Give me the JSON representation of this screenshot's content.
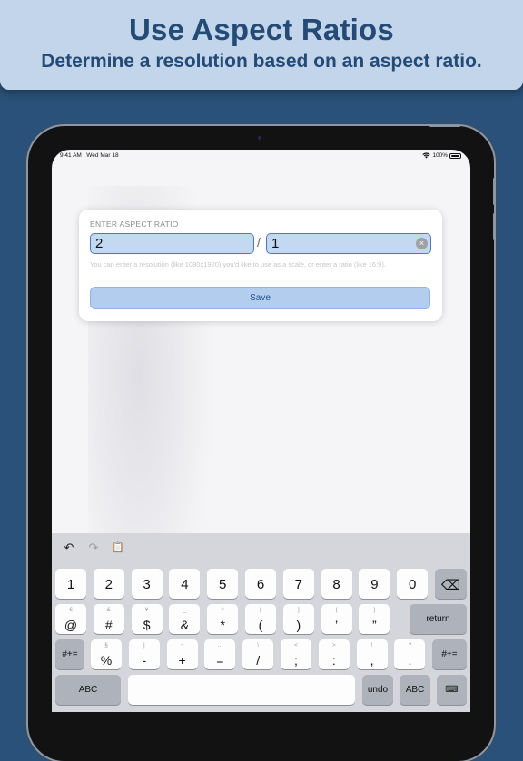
{
  "banner": {
    "title": "Use Aspect Ratios",
    "subtitle": "Determine a resolution based on an aspect ratio."
  },
  "status_bar": {
    "time": "9:41 AM",
    "date": "Wed Mar 18",
    "battery": "100%"
  },
  "dialog": {
    "label": "ENTER ASPECT RATIO",
    "width_value": "2",
    "separator": "/",
    "height_value": "1",
    "clear_glyph": "×",
    "hint": "You can enter a resolution (like 1080x1920) you'd like to use as a scale, or enter a ratio (like 16:9).",
    "save_label": "Save"
  },
  "keyboard": {
    "toolbar": {
      "undo_glyph": "↶",
      "redo_glyph": "↷",
      "paste_glyph": "📋"
    },
    "row1": [
      "1",
      "2",
      "3",
      "4",
      "5",
      "6",
      "7",
      "8",
      "9",
      "0"
    ],
    "delete_glyph": "⌫",
    "row2": [
      {
        "alt": "€",
        "main": "@"
      },
      {
        "alt": "£",
        "main": "#"
      },
      {
        "alt": "¥",
        "main": "$"
      },
      {
        "alt": "_",
        "main": "&"
      },
      {
        "alt": "^",
        "main": "*"
      },
      {
        "alt": "[",
        "main": "("
      },
      {
        "alt": "]",
        "main": ")"
      },
      {
        "alt": "{",
        "main": "’"
      },
      {
        "alt": "}",
        "main": "”"
      }
    ],
    "return_label": "return",
    "shift_label": "#+=",
    "row3": [
      {
        "alt": "§",
        "main": "%"
      },
      {
        "alt": "|",
        "main": "-"
      },
      {
        "alt": "~",
        "main": "+"
      },
      {
        "alt": "…",
        "main": "="
      },
      {
        "alt": "\\",
        "main": "/"
      },
      {
        "alt": "<",
        "main": ";"
      },
      {
        "alt": ">",
        "main": ":"
      },
      {
        "alt": "!",
        "main": ","
      },
      {
        "alt": "?",
        "main": "."
      }
    ],
    "abc_label": "ABC",
    "undo_label": "undo",
    "keyboard_glyph": "⌨"
  },
  "colors": {
    "background": "#2a5179",
    "banner": "#c3d5ea",
    "accent": "#25558f"
  }
}
